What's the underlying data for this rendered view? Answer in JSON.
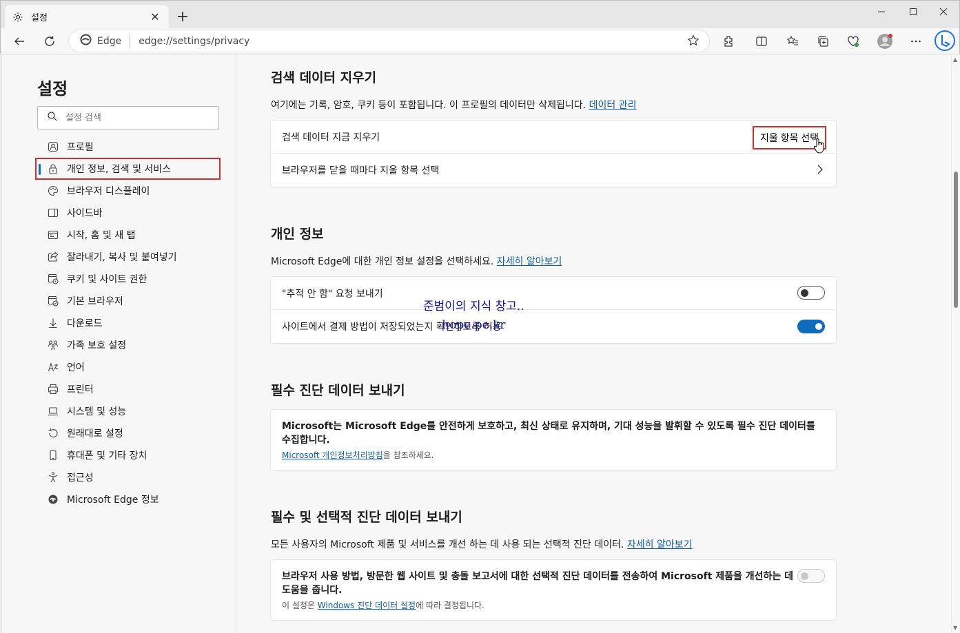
{
  "tab": {
    "title": "설정",
    "icon": "gear-icon"
  },
  "address": {
    "site_label": "Edge",
    "url": "edge://settings/privacy"
  },
  "sidebar": {
    "title": "설정",
    "search_placeholder": "설정 검색",
    "items": [
      {
        "label": "프로필",
        "icon": "profile-icon"
      },
      {
        "label": "개인 정보, 검색 및 서비스",
        "icon": "lock-icon",
        "active": true
      },
      {
        "label": "브라우저 디스플레이",
        "icon": "palette-icon"
      },
      {
        "label": "사이드바",
        "icon": "sidebar-icon"
      },
      {
        "label": "시작, 홈 및 새 탭",
        "icon": "home-tab-icon"
      },
      {
        "label": "잘라내기, 복사 및 붙여넣기",
        "icon": "share-icon"
      },
      {
        "label": "쿠키 및 사이트 권한",
        "icon": "cookie-icon"
      },
      {
        "label": "기본 브라우저",
        "icon": "default-browser-icon"
      },
      {
        "label": "다운로드",
        "icon": "download-icon"
      },
      {
        "label": "가족 보호 설정",
        "icon": "family-icon"
      },
      {
        "label": "언어",
        "icon": "language-icon"
      },
      {
        "label": "프린터",
        "icon": "printer-icon"
      },
      {
        "label": "시스템 및 성능",
        "icon": "laptop-icon"
      },
      {
        "label": "원래대로 설정",
        "icon": "reset-icon"
      },
      {
        "label": "휴대폰 및 기타 장치",
        "icon": "phone-icon"
      },
      {
        "label": "접근성",
        "icon": "accessibility-icon"
      },
      {
        "label": "Microsoft Edge 정보",
        "icon": "edge-logo-icon"
      }
    ]
  },
  "clear_data": {
    "heading": "검색 데이터 지우기",
    "desc": "여기에는 기록, 암호, 쿠키 등이 포함됩니다. 이 프로필의 데이터만 삭제됩니다.",
    "desc_link": "데이터 관리",
    "row1_label": "검색 데이터 지금 지우기",
    "row1_button": "지울 항목 선택",
    "row2_label": "브라우저를 닫을 때마다 지울 항목 선택"
  },
  "privacy": {
    "heading": "개인 정보",
    "desc": "Microsoft Edge에 대한 개인 정보 설정을 선택하세요.",
    "desc_link": "자세히 알아보기",
    "row1_label": "\"추적 안 함\" 요청 보내기",
    "row1_toggle": "off",
    "row2_label": "사이트에서 결제 방법이 저장되었는지 확인하도록 허용",
    "row2_toggle": "on"
  },
  "required_diag": {
    "heading": "필수 진단 데이터 보내기",
    "text": "Microsoft는 Microsoft Edge를 안전하게 보호하고, 최신 상태로 유지하며, 기대 성능을 발휘할 수 있도록 필수 진단 데이터를 수집합니다.",
    "link": "Microsoft 개인정보처리방침",
    "link_suffix": "을 참조하세요."
  },
  "optional_diag": {
    "heading": "필수 및 선택적 진단 데이터 보내기",
    "desc": "모든 사용자의 Microsoft 제품 및 서비스를 개선 하는 데 사용 되는 선택적 진단 데이터.",
    "desc_link": "자세히 알아보기",
    "row_label": "브라우저 사용 방법, 방문한 웹 사이트 및 충돌 보고서에 대한 선택적 진단 데이터를 전송하여 Microsoft 제품을 개선하는 데 도움을 줍니다.",
    "row_note_prefix": "이 설정은 ",
    "row_note_link": "Windows 진단 데이터 설정",
    "row_note_suffix": "에 따라 결정됩니다.",
    "row_toggle": "disabled"
  },
  "watermark": {
    "line1": "준범이의 지식 창고..",
    "line2": "hope.pe.kr"
  }
}
